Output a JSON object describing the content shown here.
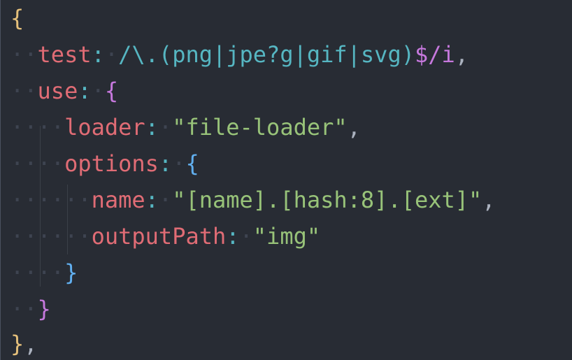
{
  "code": {
    "line1": {
      "brace": "{"
    },
    "line2": {
      "key": "test",
      "colon": ":",
      "regex_body": "/\\.(png|jpe?g|gif|svg)",
      "regex_end": "$/i",
      "comma": ","
    },
    "line3": {
      "key": "use",
      "colon": ":",
      "brace": "{"
    },
    "line4": {
      "key": "loader",
      "colon": ":",
      "value": "\"file-loader\"",
      "comma": ","
    },
    "line5": {
      "key": "options",
      "colon": ":",
      "brace": "{"
    },
    "line6": {
      "key": "name",
      "colon": ":",
      "value": "\"[name].[hash:8].[ext]\"",
      "comma": ","
    },
    "line7": {
      "key": "outputPath",
      "colon": ":",
      "value": "\"img\""
    },
    "line8": {
      "brace": "}"
    },
    "line9": {
      "brace": "}"
    },
    "line10": {
      "brace": "}",
      "comma": ","
    }
  },
  "colors": {
    "background": "#282c34",
    "key": "#e06c75",
    "string": "#98c379",
    "regex": "#56b6c2",
    "brace_outer": "#e5c07b",
    "brace_mid": "#c678dd",
    "brace_inner": "#61afef"
  }
}
